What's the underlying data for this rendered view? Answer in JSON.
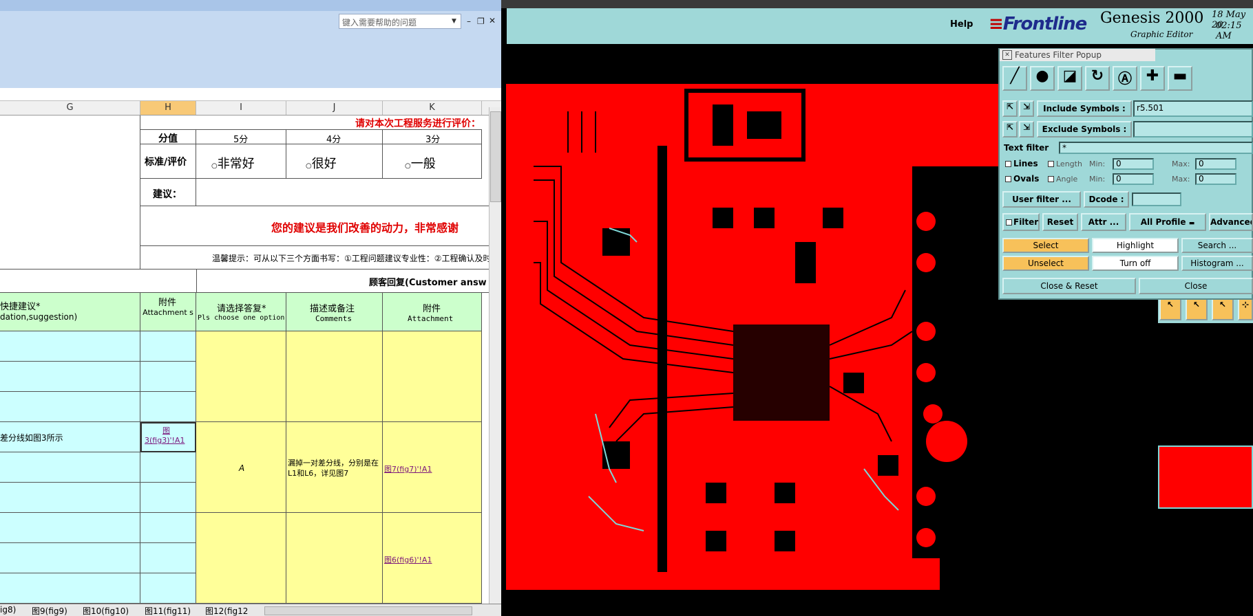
{
  "excel": {
    "help_placeholder": "键入需要帮助的问题",
    "columns": [
      "G",
      "H",
      "I",
      "J",
      "K"
    ],
    "title_prompt": "请对本次工程服务进行评价：",
    "score_label": "分值",
    "scores": [
      "5分",
      "4分",
      "3分"
    ],
    "criteria_label": "标准/评价",
    "ratings": [
      "非常好",
      "很好",
      "一般"
    ],
    "suggestion_label": "建议：",
    "thanks_text": "您的建议是我们改善的动力，非常感谢",
    "tip_text": "温馨提示：可从以下三个方面书写：①工程问题建议专业性：②工程确认及时",
    "customer_reply": "顾客回复(Customer answ",
    "hdr_advice_cn": "快捷建议*",
    "hdr_advice_en": "dation,suggestion)",
    "hdr_attach_cn": "附件",
    "hdr_attach_en": "Attachment s",
    "hdr_choose_cn": "请选择答复*",
    "hdr_choose_en": "Pls choose one option",
    "hdr_comment_cn": "描述或备注",
    "hdr_comment_en": "Comments",
    "hdr_attach2_cn": "附件",
    "hdr_attach2_en": "Attachment",
    "row_text": "差分线如图3所示",
    "link_fig3a": "图",
    "link_fig3b": "3(fig3)'!A1",
    "answer_a": "A",
    "comment_text": "漏掉一对差分线，分别是在L1和L6，详见图7",
    "link_fig7": "图7(fig7)'!A1",
    "link_fig6": "图6(fig6)'!A1",
    "sheet_tabs": [
      "ig8)",
      "图9(fig9)",
      "图10(fig10)",
      "图11(fig11)",
      "图12(fig12"
    ]
  },
  "genesis": {
    "help": "Help",
    "brand": "Frontline",
    "product": "Genesis 2000",
    "subtitle": "Graphic Editor",
    "date": "18 May 20",
    "time": "02:15 AM",
    "popup": {
      "title": "Features Filter Popup",
      "include_label": "Include Symbols :",
      "include_value": "r5.501",
      "exclude_label": "Exclude Symbols :",
      "exclude_value": "",
      "text_filter_label": "Text filter",
      "text_filter_value": "*",
      "lines_label": "Lines",
      "ovals_label": "Ovals",
      "length_label": "Length",
      "angle_label": "Angle",
      "min_label": "Min:",
      "max_label": "Max:",
      "zero": "0",
      "user_filter": "User filter ...",
      "dcode_label": "Dcode :",
      "dcode_value": "",
      "filter": "Filter",
      "reset": "Reset",
      "attr": "Attr ...",
      "all_profile": "All Profile",
      "advanced": "Advanced",
      "select": "Select",
      "highlight": "Highlight",
      "search": "Search ...",
      "unselect": "Unselect",
      "turn_off": "Turn off",
      "histogram": "Histogram ...",
      "close_reset": "Close & Reset",
      "close": "Close"
    }
  },
  "colors": {
    "board_red": "#ff0000",
    "panel_cyan": "#9fd8d8",
    "excel_blue": "#c5d9f1",
    "cell_yellow": "#ffff99",
    "cell_cyan": "#ccffff",
    "cell_green": "#ccffcc"
  }
}
